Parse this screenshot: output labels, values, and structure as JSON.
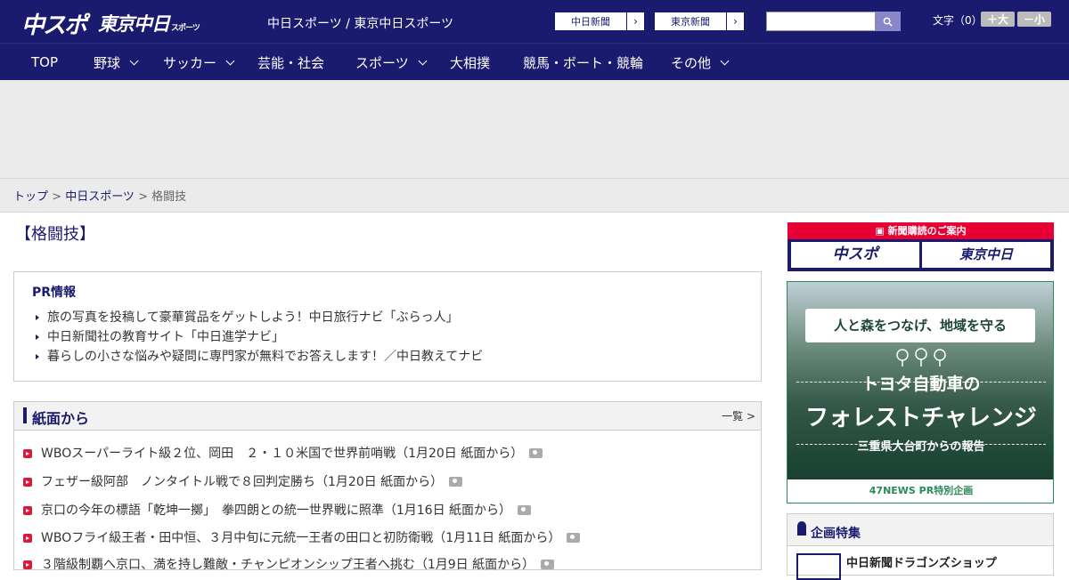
{
  "header": {
    "logo_chuspo": "中スポ",
    "logo_tokyo": "東京中日",
    "logo_tokyo_small": "スポーツ",
    "site_links": "中日スポーツ / 東京中日スポーツ",
    "paper_buttons": [
      "中日新聞",
      "東京新聞"
    ],
    "font_size_label": "文字（0）",
    "font_bigger": "＋大",
    "font_smaller": "－小"
  },
  "nav": {
    "items": [
      "TOP",
      "野球",
      "サッカー",
      "芸能・社会",
      "スポーツ",
      "大相撲",
      "競馬・ボート・競輪",
      "その他"
    ]
  },
  "breadcrumb": {
    "top": "トップ",
    "sep1": " > ",
    "chunichi": "中日スポーツ",
    "sep2": " > ",
    "current": "格闘技"
  },
  "page": {
    "title": "【格闘技】"
  },
  "pr": {
    "title": "PR情報",
    "items": [
      "旅の写真を投稿して豪華賞品をゲットしよう！中日旅行ナビ「ぶらっ人」",
      "中日新聞社の教育サイト「中日進学ナビ」",
      "暮らしの小さな悩みや疑問に専門家が無料でお答えします！／中日教えてナビ"
    ]
  },
  "news": {
    "title": "紙面から",
    "more": "一覧 >",
    "items": [
      "WBOスーパーライト級２位、岡田　２・１０米国で世界前哨戦（1月20日 紙面から）",
      "フェザー級阿部　ノンタイトル戦で８回判定勝ち（1月20日 紙面から）",
      "京口の今年の標語「乾坤一擲」　拳四朗との統一世界戦に照準（1月16日 紙面から）",
      "WBOフライ級王者・田中恒、３月中旬に元統一王者の田口と初防衛戦（1月11日 紙面から）",
      "３階級制覇へ京口、満を持し難敵・チャンピオンシップ王者へ挑む（1月9日 紙面から）"
    ]
  },
  "sidebar": {
    "subscribe_title": "新聞購読のご案内",
    "subscribe_left": "中スポ",
    "subscribe_right": "東京中日",
    "ad_ribbon": "人と森をつなげ、地域を守る",
    "ad_title1": "トヨタ自動車の",
    "ad_title2": "フォレストチャレンジ",
    "ad_sub": "三重県大台町からの報告",
    "ad_foot": "47NEWS PR特別企画",
    "feature_title": "企画特集",
    "feature_item": "中日新聞ドラゴンズショップ"
  },
  "colors": {
    "navy": "#1a1a6e",
    "red": "#d61c3a",
    "accent_red": "#e60033"
  }
}
